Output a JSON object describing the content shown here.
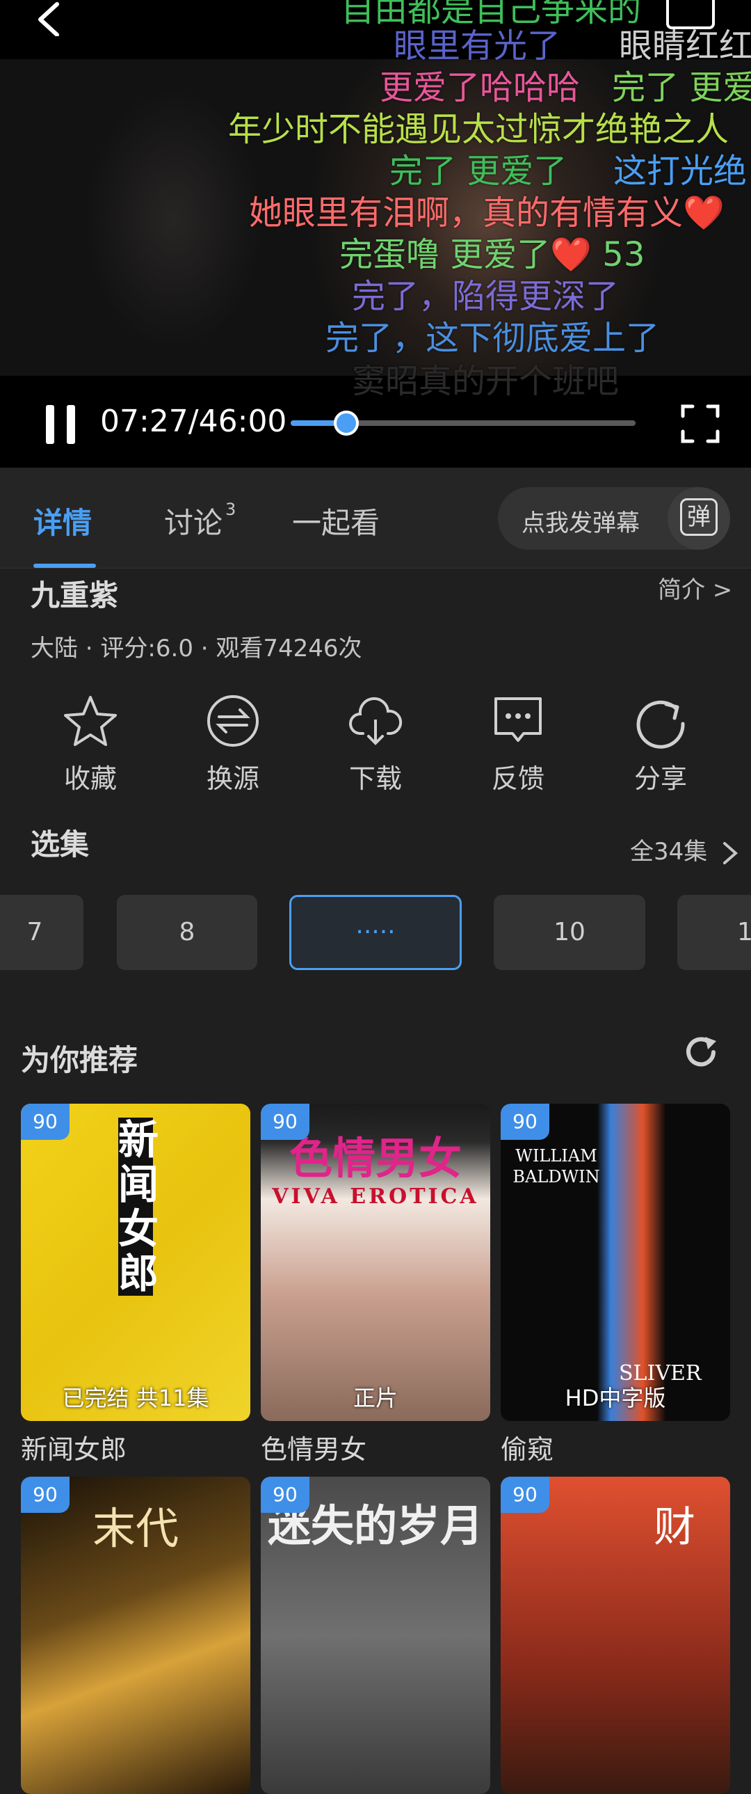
{
  "danmaku": [
    {
      "text": "自由都是自己争来的",
      "color": "#3fbf5a"
    },
    {
      "text": "眼里有光了",
      "color": "#5b63c9"
    },
    {
      "text": "眼睛红红",
      "color": "#cfcfcf"
    },
    {
      "text": "更爱了哈哈哈",
      "color": "#e8579a"
    },
    {
      "text": "完了 更爱",
      "color": "#7fd35a"
    },
    {
      "text": "年少时不能遇见太过惊才绝艳之人",
      "color": "#b8e04a"
    },
    {
      "text": "完了 更爱了",
      "color": "#3fbf5a"
    },
    {
      "text": "这打光绝",
      "color": "#4a9ff5"
    },
    {
      "text": "她眼里有泪啊，真的有情有义❤️",
      "color": "#ff6b6b"
    },
    {
      "text": "完蛋噜 更爱了❤️ 53",
      "color": "#6fd36f"
    },
    {
      "text": "完了，陷得更深了",
      "color": "#7b6bd6"
    },
    {
      "text": "完了，这下彻底爱上了",
      "color": "#4a8fe0"
    },
    {
      "text": "窦昭真的开个班吧",
      "color": "#2a2a2a"
    }
  ],
  "player": {
    "time": "07:27/46:00",
    "progress": 0.162
  },
  "tabs": [
    {
      "label": "详情",
      "sup": ""
    },
    {
      "label": "讨论",
      "sup": "3"
    },
    {
      "label": "一起看",
      "sup": ""
    }
  ],
  "danmaku_input": {
    "placeholder": "点我发弹幕",
    "icon_label": "弹"
  },
  "detail": {
    "title": "九重紫",
    "intro": "简介 >",
    "meta": "大陆 · 评分:6.0 · 观看74246次"
  },
  "actions": [
    {
      "label": "收藏",
      "icon": "star-icon"
    },
    {
      "label": "换源",
      "icon": "switch-source-icon"
    },
    {
      "label": "下载",
      "icon": "cloud-download-icon"
    },
    {
      "label": "反馈",
      "icon": "feedback-icon"
    },
    {
      "label": "分享",
      "icon": "share-icon"
    }
  ],
  "episodes": {
    "title": "选集",
    "all": "全34集",
    "items": [
      "7",
      "8",
      "·····",
      "10",
      "1"
    ]
  },
  "recommend": {
    "title": "为你推荐",
    "cards": [
      {
        "name": "新闻女郎",
        "score": "90",
        "status": "已完结 共11集",
        "poster_text": "新闻女郎"
      },
      {
        "name": "色情男女",
        "score": "90",
        "status": "正片",
        "poster_text": "色情男女",
        "poster_sub": "VIVA EROTICA"
      },
      {
        "name": "偷窥",
        "score": "90",
        "status": "HD中字版",
        "poster_text": "WILLIAM BALDWIN",
        "poster_sub": "SLIVER"
      },
      {
        "name": "",
        "score": "90",
        "status": "",
        "poster_text": "末代"
      },
      {
        "name": "",
        "score": "90",
        "status": "",
        "poster_text": "迷失的岁月"
      },
      {
        "name": "",
        "score": "90",
        "status": "",
        "poster_text": "财"
      }
    ]
  }
}
